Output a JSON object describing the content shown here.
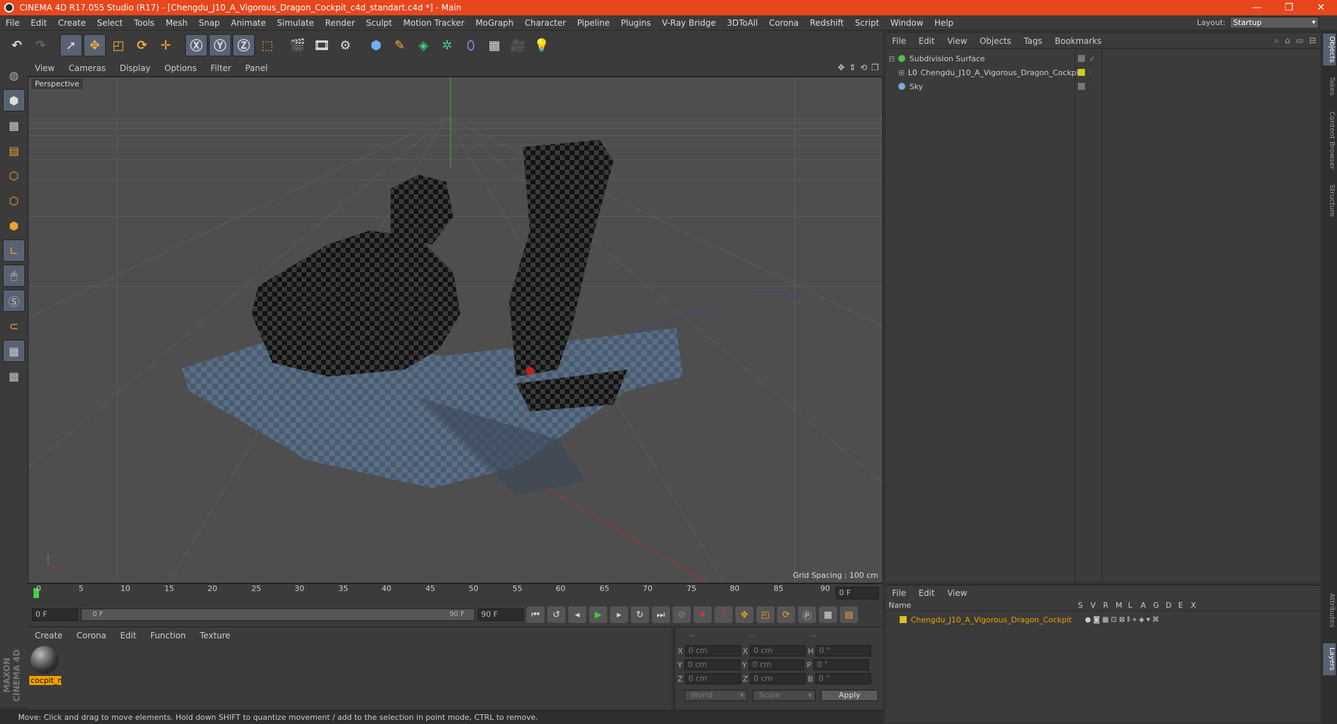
{
  "window": {
    "title": "CINEMA 4D R17.055 Studio (R17) - [Chengdu_J10_A_Vigorous_Dragon_Cockpit_c4d_standart.c4d *] - Main",
    "controls": [
      "—",
      "❐",
      "✕"
    ]
  },
  "menubar": {
    "items": [
      "File",
      "Edit",
      "Create",
      "Select",
      "Tools",
      "Mesh",
      "Snap",
      "Animate",
      "Simulate",
      "Render",
      "Sculpt",
      "Motion Tracker",
      "MoGraph",
      "Character",
      "Pipeline",
      "Plugins",
      "V-Ray Bridge",
      "3DToAll",
      "Corona",
      "Redshift",
      "Script",
      "Window",
      "Help"
    ],
    "layout_label": "Layout:",
    "layout_value": "Startup"
  },
  "viewport": {
    "menu": [
      "View",
      "Cameras",
      "Display",
      "Options",
      "Filter",
      "Panel"
    ],
    "label": "Perspective",
    "grid_spacing": "Grid Spacing : 100 cm"
  },
  "timeline": {
    "ticks": [
      "0",
      "5",
      "10",
      "15",
      "20",
      "25",
      "30",
      "35",
      "40",
      "45",
      "50",
      "55",
      "60",
      "65",
      "70",
      "75",
      "80",
      "85",
      "90"
    ],
    "current_frame": "0 F",
    "start_field": "0 F",
    "range_start": "0 F",
    "range_end": "90 F",
    "end_field": "90 F"
  },
  "material_manager": {
    "menu": [
      "Create",
      "Corona",
      "Edit",
      "Function",
      "Texture"
    ],
    "materials": [
      {
        "name": "cocpit_m"
      }
    ]
  },
  "coordinates": {
    "headers": [
      "--",
      "--",
      "--"
    ],
    "rows": [
      {
        "a": "X",
        "av": "0 cm",
        "b": "X",
        "bv": "0 cm",
        "c": "H",
        "cv": "0 °"
      },
      {
        "a": "Y",
        "av": "0 cm",
        "b": "Y",
        "bv": "0 cm",
        "c": "P",
        "cv": "0 °"
      },
      {
        "a": "Z",
        "av": "0 cm",
        "b": "Z",
        "bv": "0 cm",
        "c": "B",
        "cv": "0 °"
      }
    ],
    "mode1": "World",
    "mode2": "Scale",
    "apply": "Apply"
  },
  "status": "Move: Click and drag to move elements. Hold down SHIFT to quantize movement / add to the selection in point mode, CTRL to remove.",
  "object_manager": {
    "menu": [
      "File",
      "Edit",
      "View",
      "Objects",
      "Tags",
      "Bookmarks"
    ],
    "objects": [
      {
        "name": "Subdivision Surface",
        "color": "#4ec04e"
      },
      {
        "name": "Chengdu_J10_A_Vigorous_Dragon_Cockpit",
        "color": "#cfcf20"
      },
      {
        "name": "Sky",
        "color": "#7fa8d8"
      }
    ]
  },
  "layer_manager": {
    "menu": [
      "File",
      "Edit",
      "View"
    ],
    "columns": [
      "Name",
      "S",
      "V",
      "R",
      "M",
      "L",
      "A",
      "G",
      "D",
      "E",
      "X"
    ],
    "layers": [
      {
        "name": "Chengdu_J10_A_Vigorous_Dragon_Cockpit",
        "color": "#e0c020"
      }
    ]
  },
  "side_tabs": [
    "Objects",
    "Takes",
    "Content Browser",
    "Structure",
    "Attributes",
    "Layers"
  ],
  "branding": "MAXON CINEMA 4D",
  "colors": {
    "accent": "#e8461c",
    "selection": "#586273",
    "material_tag": "#f0a000"
  }
}
